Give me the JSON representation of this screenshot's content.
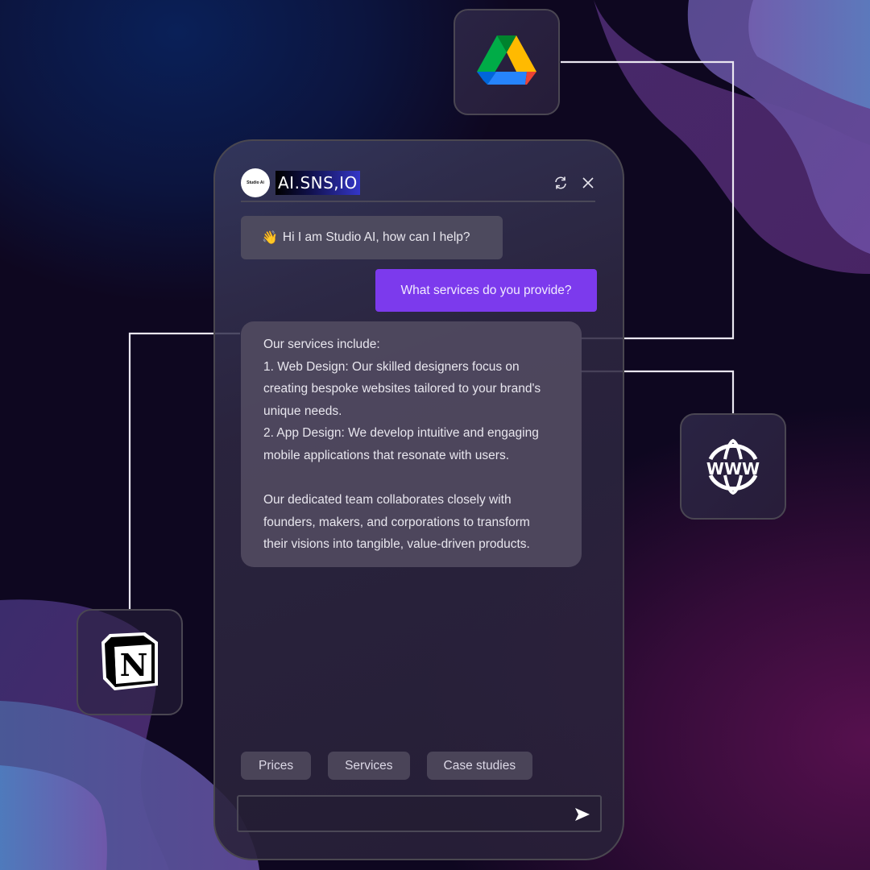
{
  "colors": {
    "accent": "#7c3aed",
    "background": "#0e0720",
    "bubble_bot": "#4d4a5e",
    "connector": "#ffffff"
  },
  "integrations": [
    {
      "name": "Google Drive",
      "icon": "google-drive-icon"
    },
    {
      "name": "Website",
      "icon": "www-globe-icon"
    },
    {
      "name": "Notion",
      "icon": "notion-icon"
    }
  ],
  "chat": {
    "header": {
      "avatar_text": "Studio Ai",
      "brand_text": "AI.SNS,IO",
      "refresh_icon": "refresh-icon",
      "close_icon": "close-icon"
    },
    "messages": [
      {
        "role": "bot",
        "emoji": "👋",
        "text": "Hi I am Studio AI, how can I help?"
      },
      {
        "role": "user",
        "text": "What services do you provide?"
      },
      {
        "role": "bot",
        "lines": [
          "Our services include:",
          "1. Web Design: Our skilled designers focus on",
          "creating bespoke websites tailored to your brand's",
          "unique needs.",
          "2. App Design: We develop intuitive and engaging",
          "mobile applications that resonate with users.",
          "",
          "Our dedicated team collaborates closely with",
          "founders, makers, and corporations to transform",
          "their visions into tangible, value-driven products."
        ]
      }
    ],
    "quick_replies": [
      "Prices",
      "Services",
      "Case studies"
    ],
    "input": {
      "value": "",
      "placeholder": ""
    },
    "send_icon": "send-icon"
  }
}
